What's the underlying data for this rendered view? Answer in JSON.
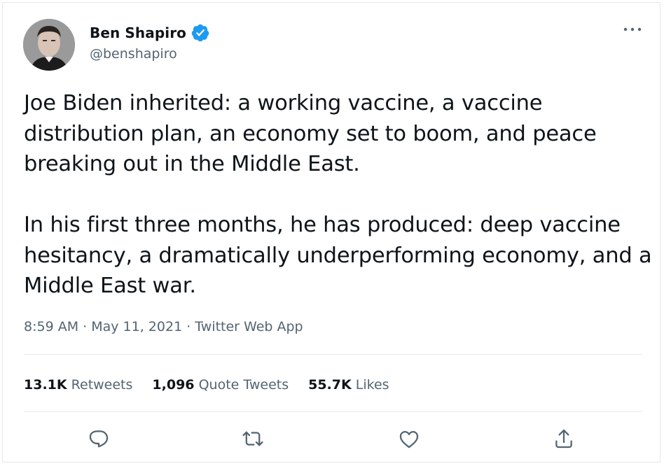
{
  "author": {
    "name": "Ben Shapiro",
    "handle": "@benshapiro",
    "verified": true,
    "verified_icon": "verified-badge-icon"
  },
  "tweet": {
    "paragraphs": [
      "Joe Biden inherited: a working vaccine, a vaccine distribution plan, an economy set to boom, and peace breaking out in the Middle East.",
      "In his first three months, he has produced: deep vaccine hesitancy, a dramatically underperforming economy, and a Middle East war."
    ],
    "time": "8:59 AM",
    "separator": " · ",
    "date": "May 11, 2021",
    "source": "Twitter Web App"
  },
  "stats": {
    "retweets_count": "13.1K",
    "retweets_label": "Retweets",
    "quotes_count": "1,096",
    "quotes_label": "Quote Tweets",
    "likes_count": "55.7K",
    "likes_label": "Likes"
  },
  "actions": {
    "reply_icon": "reply-icon",
    "retweet_icon": "retweet-icon",
    "like_icon": "heart-icon",
    "share_icon": "share-icon",
    "more_icon": "more-options-icon"
  },
  "colors": {
    "text": "#0f1419",
    "secondary": "#536471",
    "verified": "#1d9bf0",
    "divider": "#e6ecf0"
  }
}
